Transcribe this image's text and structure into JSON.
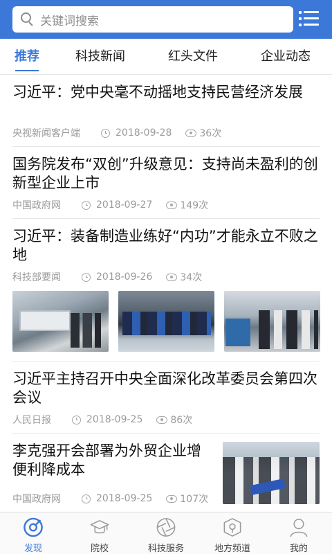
{
  "search": {
    "placeholder": "关键词搜索"
  },
  "tabs": [
    {
      "label": "推荐"
    },
    {
      "label": "科技新闻"
    },
    {
      "label": "红头文件"
    },
    {
      "label": "企业动态"
    }
  ],
  "articles": [
    {
      "title": "习近平：党中央毫不动摇地支持民营经济发展",
      "source": "央视新闻客户端",
      "date": "2018-09-28",
      "views": "36次"
    },
    {
      "title": "国务院发布“双创”升级意见：支持尚未盈利的创新型企业上市",
      "source": "中国政府网",
      "date": "2018-09-27",
      "views": "149次"
    },
    {
      "title": "习近平：装备制造业练好“内功”才能永立不败之地",
      "source": "科技部要闻",
      "date": "2018-09-26",
      "views": "34次"
    },
    {
      "title": "习近平主持召开中央全面深化改革委员会第四次会议",
      "source": "人民日报",
      "date": "2018-09-25",
      "views": "86次"
    },
    {
      "title": "李克强开会部署为外贸企业增便利降成本",
      "source": "中国政府网",
      "date": "2018-09-25",
      "views": "107次"
    }
  ],
  "bottom_nav": [
    {
      "label": "发现"
    },
    {
      "label": "院校"
    },
    {
      "label": "科技服务"
    },
    {
      "label": "地方频道"
    },
    {
      "label": "我的"
    }
  ],
  "colors": {
    "accent": "#3c78d8"
  }
}
